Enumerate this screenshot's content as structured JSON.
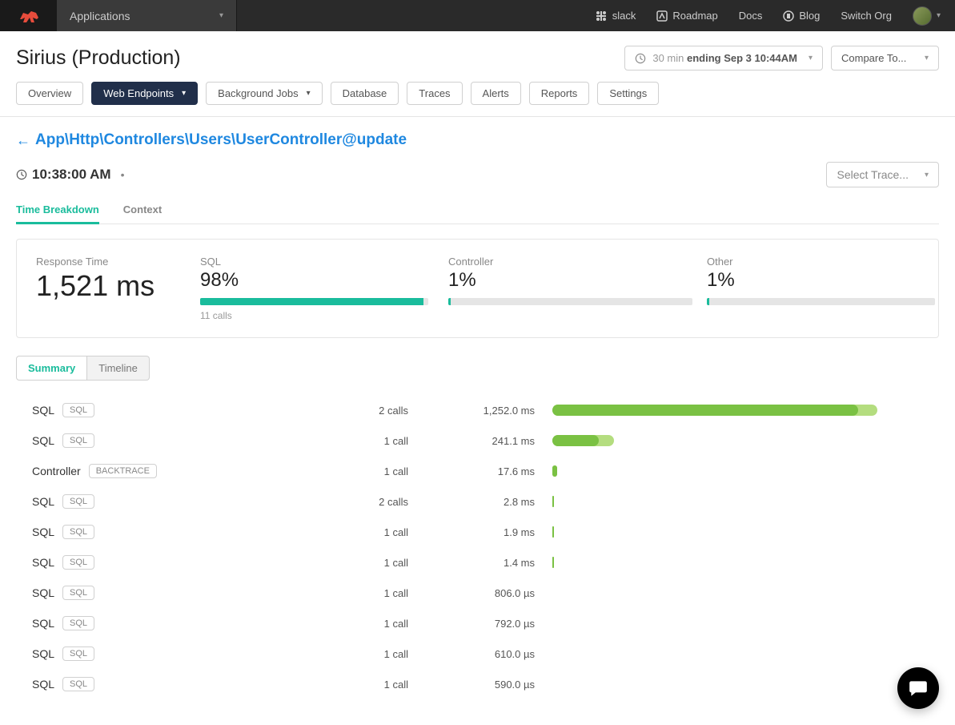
{
  "topnav": {
    "apps_label": "Applications",
    "links": {
      "slack": "slack",
      "roadmap": "Roadmap",
      "docs": "Docs",
      "blog": "Blog",
      "switch_org": "Switch Org"
    }
  },
  "header": {
    "app_title": "Sirius (Production)",
    "timerange_prefix": "30 min ",
    "timerange_bold": "ending Sep 3 10:44AM",
    "compare": "Compare To...",
    "tabs": {
      "overview": "Overview",
      "web_endpoints": "Web Endpoints",
      "background_jobs": "Background Jobs",
      "database": "Database",
      "traces": "Traces",
      "alerts": "Alerts",
      "reports": "Reports",
      "settings": "Settings"
    }
  },
  "breadcrumb": {
    "arrow": "←",
    "text": "App\\Http\\Controllers\\Users\\UserController@update"
  },
  "timestamp": "10:38:00 AM",
  "select_trace": "Select Trace...",
  "subtabs": {
    "time_breakdown": "Time Breakdown",
    "context": "Context"
  },
  "metrics": {
    "response_time": {
      "label": "Response Time",
      "value": "1,521 ms"
    },
    "sql": {
      "label": "SQL",
      "value": "98%",
      "sub": "11 calls",
      "pct": 98
    },
    "controller": {
      "label": "Controller",
      "value": "1%",
      "pct": 1
    },
    "other": {
      "label": "Other",
      "value": "1%",
      "pct": 1
    }
  },
  "mode_tabs": {
    "summary": "Summary",
    "timeline": "Timeline"
  },
  "calls": [
    {
      "name": "SQL",
      "badge": "SQL",
      "calls": "2 calls",
      "time": "1,252.0 ms",
      "bar_a": 84,
      "bar_b": 79
    },
    {
      "name": "SQL",
      "badge": "SQL",
      "calls": "1 call",
      "time": "241.1 ms",
      "bar_a": 16,
      "bar_b": 12
    },
    {
      "name": "Controller",
      "badge": "BACKTRACE",
      "calls": "1 call",
      "time": "17.6 ms",
      "bar_a": 1.2,
      "bar_b": 1.2
    },
    {
      "name": "SQL",
      "badge": "SQL",
      "calls": "2 calls",
      "time": "2.8 ms",
      "bar_a": 0.5,
      "bar_b": 0.5
    },
    {
      "name": "SQL",
      "badge": "SQL",
      "calls": "1 call",
      "time": "1.9 ms",
      "bar_a": 0.5,
      "bar_b": 0.5
    },
    {
      "name": "SQL",
      "badge": "SQL",
      "calls": "1 call",
      "time": "1.4 ms",
      "bar_a": 0.5,
      "bar_b": 0.5
    },
    {
      "name": "SQL",
      "badge": "SQL",
      "calls": "1 call",
      "time": "806.0 µs",
      "bar_a": 0,
      "bar_b": 0
    },
    {
      "name": "SQL",
      "badge": "SQL",
      "calls": "1 call",
      "time": "792.0 µs",
      "bar_a": 0,
      "bar_b": 0
    },
    {
      "name": "SQL",
      "badge": "SQL",
      "calls": "1 call",
      "time": "610.0 µs",
      "bar_a": 0,
      "bar_b": 0
    },
    {
      "name": "SQL",
      "badge": "SQL",
      "calls": "1 call",
      "time": "590.0 µs",
      "bar_a": 0,
      "bar_b": 0
    }
  ]
}
